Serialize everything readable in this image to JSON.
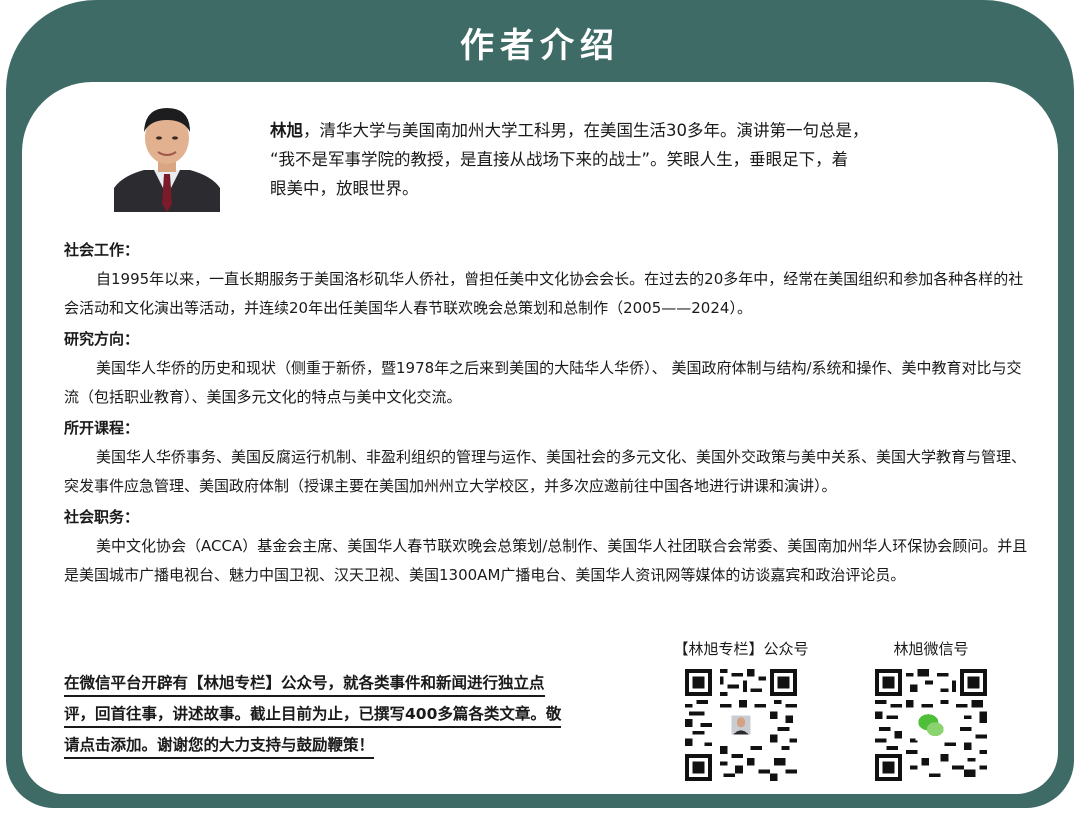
{
  "header": {
    "title": "作者介绍"
  },
  "intro": {
    "name": "林旭",
    "text_line1": "，清华大学与美国南加州大学工科男，在美国生活30多年。演讲第一句总是，",
    "text_line2": "“我不是军事学院的教授，是直接从战场下来的战士”。笑眼人生，垂眼足下，着",
    "text_line3": "眼美中，放眼世界。"
  },
  "sections": [
    {
      "heading": "社会工作：",
      "body": "自1995年以来，一直长期服务于美国洛杉矶华人侨社，曾担任美中文化协会会长。在过去的20多年中，经常在美国组织和参加各种各样的社会活动和文化演出等活动，并连续20年出任美国华人春节联欢晚会总策划和总制作（2005——2024）。"
    },
    {
      "heading": "研究方向：",
      "body": "美国华人华侨的历史和现状（侧重于新侨，暨1978年之后来到美国的大陆华人华侨）、 美国政府体制与结构/系统和操作、美中教育对比与交流（包括职业教育）、美国多元文化的特点与美中文化交流。"
    },
    {
      "heading": "所开课程：",
      "body": "美国华人华侨事务、美国反腐运行机制、非盈利组织的管理与运作、美国社会的多元文化、美国外交政策与美中关系、美国大学教育与管理、突发事件应急管理、美国政府体制（授课主要在美国加州州立大学校区，并多次应邀前往中国各地进行讲课和演讲）。"
    },
    {
      "heading": "社会职务：",
      "body": "美中文化协会（ACCA）基金会主席、美国华人春节联欢晚会总策划/总制作、美国华人社团联合会常委、美国南加州华人环保协会顾问。并且是美国城市广播电视台、魅力中国卫视、汉天卫视、美国1300AM广播电台、美国华人资讯网等媒体的访谈嘉宾和政治评论员。"
    }
  ],
  "promo": {
    "line1": "在微信平台开辟有【林旭专栏】公众号，就各类事件和新闻进行独立点",
    "line2": "评，回首往事，讲述故事。截止目前为止，已撰写400多篇各类文章。敬",
    "line3": "请点击添加。谢谢您的大力支持与鼓励鞭策！"
  },
  "qr": {
    "public_account_caption": "【林旭专栏】公众号",
    "wechat_caption": "林旭微信号"
  },
  "colors": {
    "frame": "#3f6b67",
    "background": "#ffffff",
    "text": "#1a1a1a"
  }
}
